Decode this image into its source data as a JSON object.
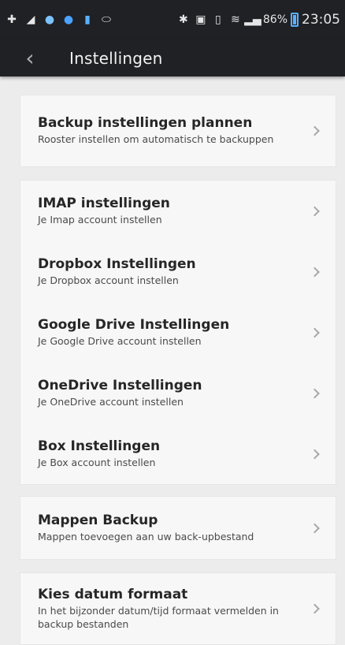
{
  "statusbar": {
    "battery_percent": "86%",
    "time": "23:05"
  },
  "appbar": {
    "title": "Instellingen"
  },
  "items": [
    {
      "title": "Backup instellingen plannen",
      "subtitle": "Rooster instellen om automatisch te backuppen"
    },
    {
      "title": "IMAP instellingen",
      "subtitle": "Je Imap account instellen"
    },
    {
      "title": "Dropbox Instellingen",
      "subtitle": "Je Dropbox account instellen"
    },
    {
      "title": "Google Drive Instellingen",
      "subtitle": "Je Google Drive account instellen"
    },
    {
      "title": "OneDrive Instellingen",
      "subtitle": "Je OneDrive account instellen"
    },
    {
      "title": "Box Instellingen",
      "subtitle": "Je Box account instellen"
    },
    {
      "title": "Mappen Backup",
      "subtitle": "Mappen toevoegen aan uw back-upbestand"
    },
    {
      "title": "Kies datum formaat",
      "subtitle": "In het bijzonder datum/tijd formaat vermelden in backup bestanden"
    }
  ]
}
